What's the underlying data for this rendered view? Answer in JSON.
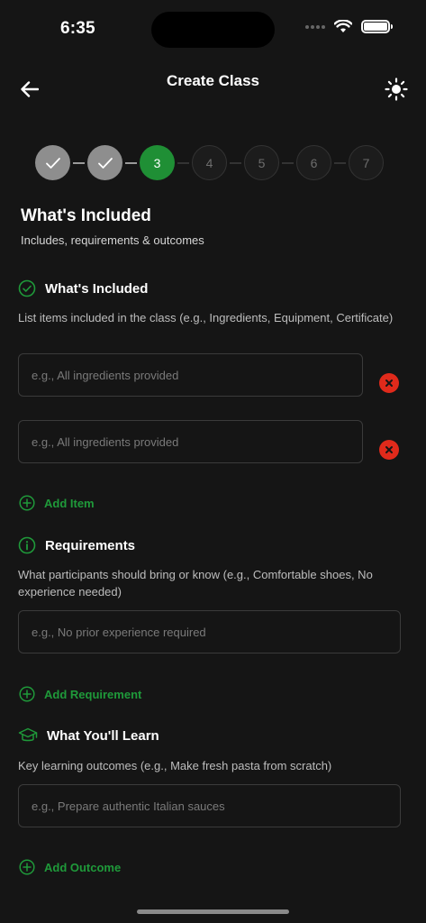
{
  "status_bar": {
    "time": "6:35"
  },
  "header": {
    "title": "Create Class",
    "back_icon": "arrow-left-icon",
    "theme_icon": "sun-icon"
  },
  "stepper": {
    "steps": [
      {
        "label": "",
        "state": "done"
      },
      {
        "label": "",
        "state": "done"
      },
      {
        "label": "3",
        "state": "active"
      },
      {
        "label": "4",
        "state": "todo"
      },
      {
        "label": "5",
        "state": "todo"
      },
      {
        "label": "6",
        "state": "todo"
      },
      {
        "label": "7",
        "state": "todo"
      }
    ]
  },
  "section": {
    "title": "What's Included",
    "subtitle": "Includes, requirements & outcomes"
  },
  "included": {
    "label": "What's Included",
    "description": "List items included in the class (e.g., Ingredients, Equipment, Certificate)",
    "items": [
      {
        "placeholder": "e.g., All ingredients provided"
      },
      {
        "placeholder": "e.g., All ingredients provided"
      }
    ],
    "add_label": "Add Item"
  },
  "requirements": {
    "label": "Requirements",
    "description": "What participants should bring or know (e.g., Comfortable shoes, No experience needed)",
    "items": [
      {
        "placeholder": "e.g., No prior experience required"
      }
    ],
    "add_label": "Add Requirement"
  },
  "outcomes": {
    "label": "What You'll Learn",
    "description": "Key learning outcomes (e.g., Make fresh pasta from scratch)",
    "items": [
      {
        "placeholder": "e.g., Prepare authentic Italian sauces"
      }
    ],
    "add_label": "Add Outcome"
  },
  "colors": {
    "accent": "#1f9a3a",
    "remove": "#e02a1b",
    "background": "#151515"
  }
}
